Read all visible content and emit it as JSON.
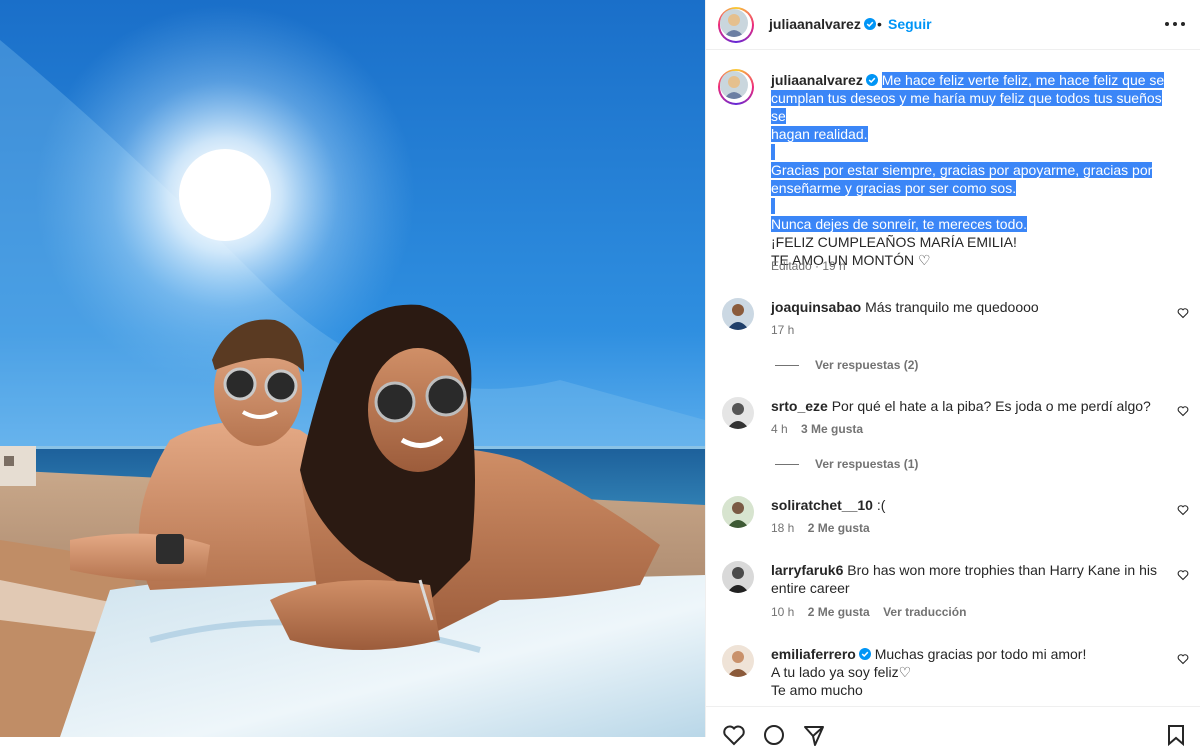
{
  "post": {
    "author": "juliaanalvarez",
    "follow_label": "Seguir",
    "dot": "•",
    "image_description": "Pareja sonriendo con gafas de sol en la playa bajo el sol",
    "caption_lines_selected": [
      "Me hace feliz verte feliz, me hace feliz que se",
      "cumplan tus deseos y me haría muy feliz que todos tus sueños se",
      "hagan realidad.",
      "",
      "Gracias por estar siempre, gracias por apoyarme, gracias por",
      "enseñarme y gracias por ser como sos.",
      "",
      "Nunca dejes de sonreír, te mereces todo."
    ],
    "caption_lines_plain": [
      "¡FELIZ CUMPLEAÑOS MARÍA EMILIA!",
      "TE AMO UN MONTÓN ♡"
    ],
    "edited_label": "Editado",
    "time": "19 h"
  },
  "comments": [
    {
      "user": "joaquinsabao",
      "text": "Más tranquilo me quedoooo",
      "time": "17 h",
      "likes": "",
      "extra": "",
      "replies": "Ver respuestas (2)",
      "verified": false
    },
    {
      "user": "srto_eze",
      "text": "Por qué el hate a la piba? Es joda o me perdí algo?",
      "time": "4 h",
      "likes": "3 Me gusta",
      "extra": "",
      "replies": "Ver respuestas (1)",
      "verified": false
    },
    {
      "user": "soliratchet__10",
      "text": ":(",
      "time": "18 h",
      "likes": "2 Me gusta",
      "extra": "",
      "replies": "",
      "verified": false
    },
    {
      "user": "larryfaruk6",
      "text": "Bro has won more trophies than Harry Kane in his entire career",
      "time": "10 h",
      "likes": "2 Me gusta",
      "extra": "Ver traducción",
      "replies": "",
      "verified": false
    },
    {
      "user": "emiliaferrero",
      "text": "Muchas gracias por todo mi amor!",
      "text2": "A tu lado ya soy feliz♡",
      "text3": "Te amo mucho",
      "verified": true
    }
  ],
  "colors": {
    "link": "#0095f6",
    "selection": "#3b86f7",
    "muted": "#737373",
    "verified": "#0095f6"
  },
  "icons": [
    "more-options-icon",
    "verified-badge-icon",
    "heart-icon",
    "comment-icon",
    "share-icon",
    "bookmark-icon"
  ]
}
